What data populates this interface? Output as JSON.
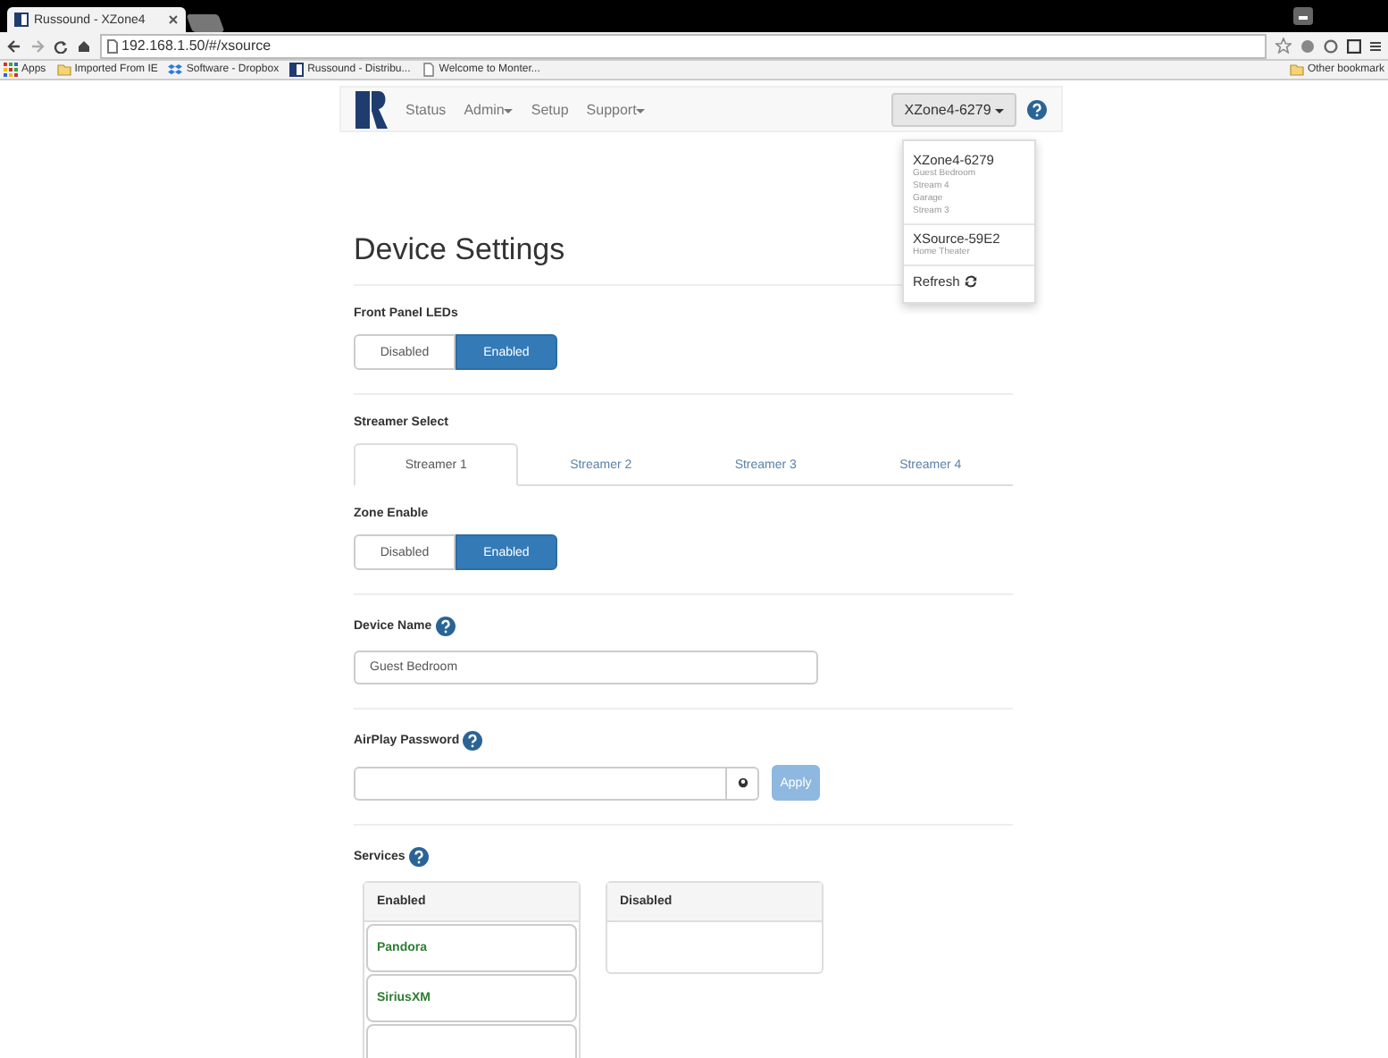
{
  "browser": {
    "tab_title": "Russound - XZone4",
    "address": "192.168.1.50/#/xsource",
    "other_bookmarks": "Other bookmark",
    "bookmarks": [
      {
        "label": "Apps",
        "kind": "apps"
      },
      {
        "label": "Imported From IE",
        "kind": "folder"
      },
      {
        "label": "Software - Dropbox",
        "kind": "dropbox"
      },
      {
        "label": "Russound - Distribu...",
        "kind": "site"
      },
      {
        "label": "Welcome to Monter...",
        "kind": "page"
      }
    ]
  },
  "navbar": {
    "device_button": "XZone4-6279",
    "items": [
      {
        "label": "Status",
        "dropdown": false
      },
      {
        "label": "Admin",
        "dropdown": true
      },
      {
        "label": "Setup",
        "dropdown": false
      },
      {
        "label": "Support",
        "dropdown": true
      }
    ]
  },
  "device_menu": {
    "refresh": "Refresh",
    "groups": [
      {
        "name": "XZone4-6279",
        "zones": [
          "Guest Bedroom",
          "Stream 4",
          "Garage",
          "Stream 3"
        ]
      },
      {
        "name": "XSource-59E2",
        "zones": [
          "Home Theater"
        ]
      }
    ]
  },
  "page_title": "Device Settings",
  "front_panel_leds": {
    "label": "Front Panel LEDs",
    "options": [
      {
        "label": "Disabled",
        "selected": false
      },
      {
        "label": "Enabled",
        "selected": true
      }
    ]
  },
  "streamer_select": {
    "label": "Streamer Select",
    "tabs": [
      {
        "label": "Streamer 1",
        "selected": true
      },
      {
        "label": "Streamer 2",
        "selected": false
      },
      {
        "label": "Streamer 3",
        "selected": false
      },
      {
        "label": "Streamer 4",
        "selected": false
      }
    ]
  },
  "zone_enable": {
    "label": "Zone Enable",
    "options": [
      {
        "label": "Disabled",
        "selected": false
      },
      {
        "label": "Enabled",
        "selected": true
      }
    ]
  },
  "device_name": {
    "label": "Device Name",
    "value": "Guest Bedroom"
  },
  "airplay_password": {
    "label": "AirPlay Password",
    "apply": "Apply",
    "apply_disabled": true
  },
  "services": {
    "label": "Services",
    "enabled": {
      "title": "Enabled",
      "items": [
        "Pandora",
        "SiriusXM"
      ]
    },
    "disabled": {
      "title": "Disabled"
    }
  }
}
